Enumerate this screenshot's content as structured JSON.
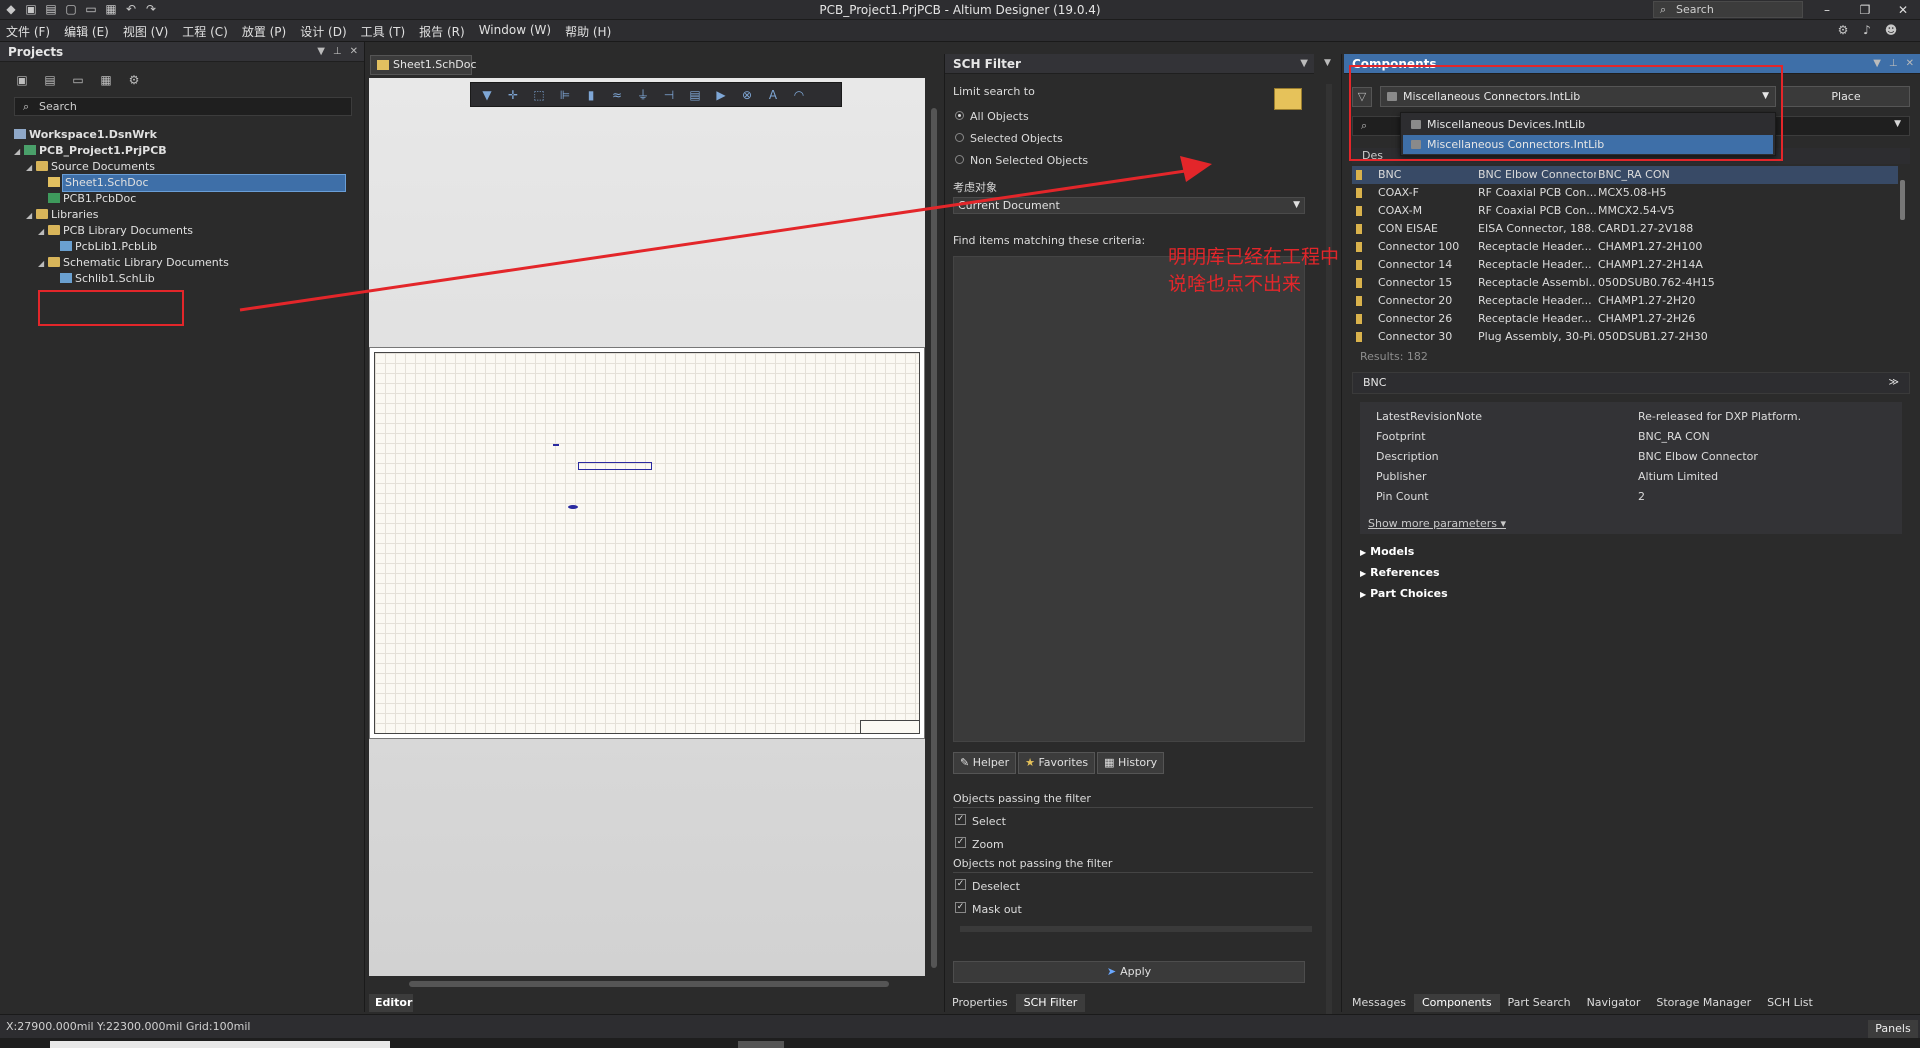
{
  "window": {
    "title": "PCB_Project1.PrjPCB - Altium Designer (19.0.4)",
    "search_placeholder": "Search"
  },
  "menu": [
    "文件 (F)",
    "编辑 (E)",
    "视图 (V)",
    "工程 (C)",
    "放置 (P)",
    "设计 (D)",
    "工具 (T)",
    "报告 (R)",
    "Window (W)",
    "帮助 (H)"
  ],
  "projects": {
    "title": "Projects",
    "search_placeholder": "Search",
    "tree": [
      {
        "label": "Workspace1.DsnWrk",
        "type": "ws"
      },
      {
        "label": "PCB_Project1.PrjPCB",
        "type": "prj"
      },
      {
        "label": "Source Documents",
        "type": "folder"
      },
      {
        "label": "Sheet1.SchDoc",
        "type": "sch"
      },
      {
        "label": "PCB1.PcbDoc",
        "type": "pcb"
      },
      {
        "label": "Libraries",
        "type": "folder"
      },
      {
        "label": "PCB Library Documents",
        "type": "folder"
      },
      {
        "label": "PcbLib1.PcbLib",
        "type": "lib"
      },
      {
        "label": "Schematic Library Documents",
        "type": "folder"
      },
      {
        "label": "Schlib1.SchLib",
        "type": "lib"
      }
    ]
  },
  "editor": {
    "tab": "Sheet1.SchDoc",
    "bottom_tab": "Editor"
  },
  "sch_filter": {
    "title": "SCH Filter",
    "limit_label": "Limit search to",
    "options": [
      "All Objects",
      "Selected Objects",
      "Non Selected Objects"
    ],
    "selected_option": "All Objects",
    "consider_label": "考虑对象",
    "consider_value": "Current Document",
    "criteria_label": "Find items matching these criteria:",
    "tabs": [
      "Helper",
      "Favorites",
      "History"
    ],
    "passing_label": "Objects passing the filter",
    "passing": [
      {
        "label": "Select",
        "checked": true
      },
      {
        "label": "Zoom",
        "checked": true
      }
    ],
    "not_passing_label": "Objects not passing the filter",
    "not_passing": [
      {
        "label": "Deselect",
        "checked": true
      },
      {
        "label": "Mask out",
        "checked": true
      }
    ],
    "apply": "Apply",
    "bottom_tabs": [
      "Properties",
      "SCH Filter"
    ],
    "active_bottom_tab": "SCH Filter"
  },
  "components": {
    "title": "Components",
    "library": "Miscellaneous Connectors.IntLib",
    "place": "Place",
    "dropdown": [
      "Miscellaneous Devices.IntLib",
      "Miscellaneous Connectors.IntLib"
    ],
    "dropdown_selected": "Miscellaneous Connectors.IntLib",
    "table_header": "Des",
    "rows": [
      {
        "name": "BNC",
        "desc": "BNC Elbow Connector",
        "footprint": "BNC_RA CON"
      },
      {
        "name": "COAX-F",
        "desc": "RF Coaxial PCB Con...",
        "footprint": "MCX5.08-H5"
      },
      {
        "name": "COAX-M",
        "desc": "RF Coaxial PCB Con...",
        "footprint": "MMCX2.54-V5"
      },
      {
        "name": "CON EISAE",
        "desc": "EISA Connector, 188...",
        "footprint": "CARD1.27-2V188"
      },
      {
        "name": "Connector 100",
        "desc": "Receptacle Header...",
        "footprint": "CHAMP1.27-2H100"
      },
      {
        "name": "Connector 14",
        "desc": "Receptacle Header...",
        "footprint": "CHAMP1.27-2H14A"
      },
      {
        "name": "Connector 15",
        "desc": "Receptacle Assembl...",
        "footprint": "050DSUB0.762-4H15"
      },
      {
        "name": "Connector 20",
        "desc": "Receptacle Header...",
        "footprint": "CHAMP1.27-2H20"
      },
      {
        "name": "Connector 26",
        "desc": "Receptacle Header...",
        "footprint": "CHAMP1.27-2H26"
      },
      {
        "name": "Connector 30",
        "desc": "Plug Assembly, 30-Pi...",
        "footprint": "050DSUB1.27-2H30"
      }
    ],
    "results": "Results: 182",
    "detail_title": "BNC",
    "params": [
      {
        "name": "LatestRevisionNote",
        "value": "Re-released for DXP Platform."
      },
      {
        "name": "Footprint",
        "value": "BNC_RA CON"
      },
      {
        "name": "Description",
        "value": "BNC Elbow Connector"
      },
      {
        "name": "Publisher",
        "value": "Altium Limited"
      },
      {
        "name": "Pin Count",
        "value": "2"
      }
    ],
    "show_more": "Show more parameters ▾",
    "sections": [
      "Models",
      "References",
      "Part Choices"
    ],
    "bottom_tabs": [
      "Messages",
      "Components",
      "Part Search",
      "Navigator",
      "Storage Manager",
      "SCH List"
    ],
    "active_bottom_tab": "Components",
    "panels_button": "Panels"
  },
  "status": {
    "text": "X:27900.000mil Y:22300.000mil   Grid:100mil"
  },
  "annotation": {
    "text": "明明库已经在工程中\n说啥也点不出来",
    "color": "#e3262a"
  },
  "colors": {
    "accent": "#3e6fa8",
    "annotation": "#e3262a"
  }
}
